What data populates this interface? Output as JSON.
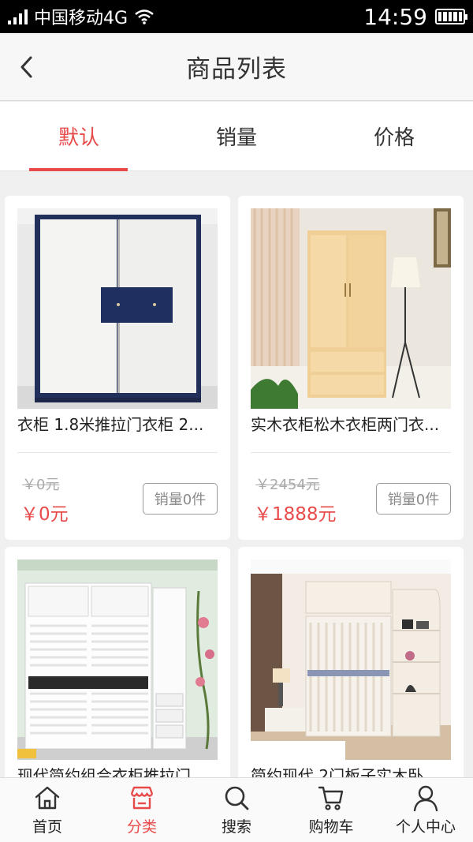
{
  "status_bar": {
    "carrier": "中国移动4G",
    "time": "14:59",
    "icons": [
      "signal-icon",
      "wifi-icon",
      "battery-icon"
    ]
  },
  "nav": {
    "title": "商品列表",
    "back_icon": "chevron-left-icon"
  },
  "sort_tabs": [
    {
      "label": "默认",
      "active": true
    },
    {
      "label": "销量",
      "active": false
    },
    {
      "label": "价格",
      "active": false
    }
  ],
  "products": [
    {
      "name": "衣柜 1.8米推拉门衣柜 2...",
      "old_price": "￥0元",
      "price": "￥0元",
      "sales": "销量0件"
    },
    {
      "name": "实木衣柜松木衣柜两门衣...",
      "old_price": "￥2454元",
      "price": "￥1888元",
      "sales": "销量0件"
    },
    {
      "name": "现代简约组合衣柜推拉门...",
      "old_price": "",
      "price": "",
      "sales": ""
    },
    {
      "name": "简约现代 2门板子实木卧...",
      "old_price": "",
      "price": "",
      "sales": ""
    }
  ],
  "tab_bar": [
    {
      "label": "首页",
      "icon": "home-icon",
      "active": false
    },
    {
      "label": "分类",
      "icon": "store-icon",
      "active": true
    },
    {
      "label": "搜索",
      "icon": "search-icon",
      "active": false
    },
    {
      "label": "购物车",
      "icon": "cart-icon",
      "active": false
    },
    {
      "label": "个人中心",
      "icon": "user-icon",
      "active": false
    }
  ],
  "colors": {
    "accent": "#e84a4a",
    "status_bar": "#000000",
    "page_background": "#f0f0f0"
  }
}
